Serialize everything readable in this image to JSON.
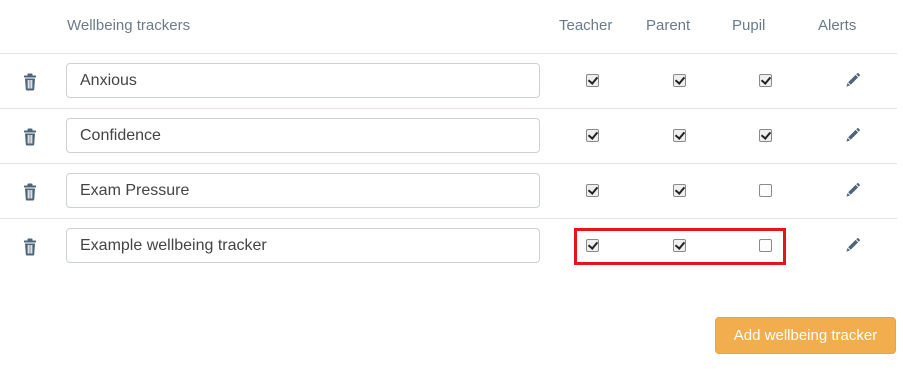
{
  "header": {
    "name_column": "Wellbeing trackers",
    "teacher_column": "Teacher",
    "parent_column": "Parent",
    "pupil_column": "Pupil",
    "alerts_column": "Alerts"
  },
  "trackers": [
    {
      "name": "Anxious",
      "teacher": true,
      "parent": true,
      "pupil": true
    },
    {
      "name": "Confidence",
      "teacher": true,
      "parent": true,
      "pupil": true
    },
    {
      "name": "Exam Pressure",
      "teacher": true,
      "parent": true,
      "pupil": false
    },
    {
      "name": "Example wellbeing tracker",
      "teacher": true,
      "parent": true,
      "pupil": false
    }
  ],
  "icons": {
    "delete": "trash-icon",
    "edit": "pencil-icon"
  },
  "add_button_label": "Add wellbeing tracker",
  "colors": {
    "header_text": "#6c7a89",
    "icon": "#4e6478",
    "button_bg": "#f1ad4e",
    "highlight": "#e8141b"
  }
}
